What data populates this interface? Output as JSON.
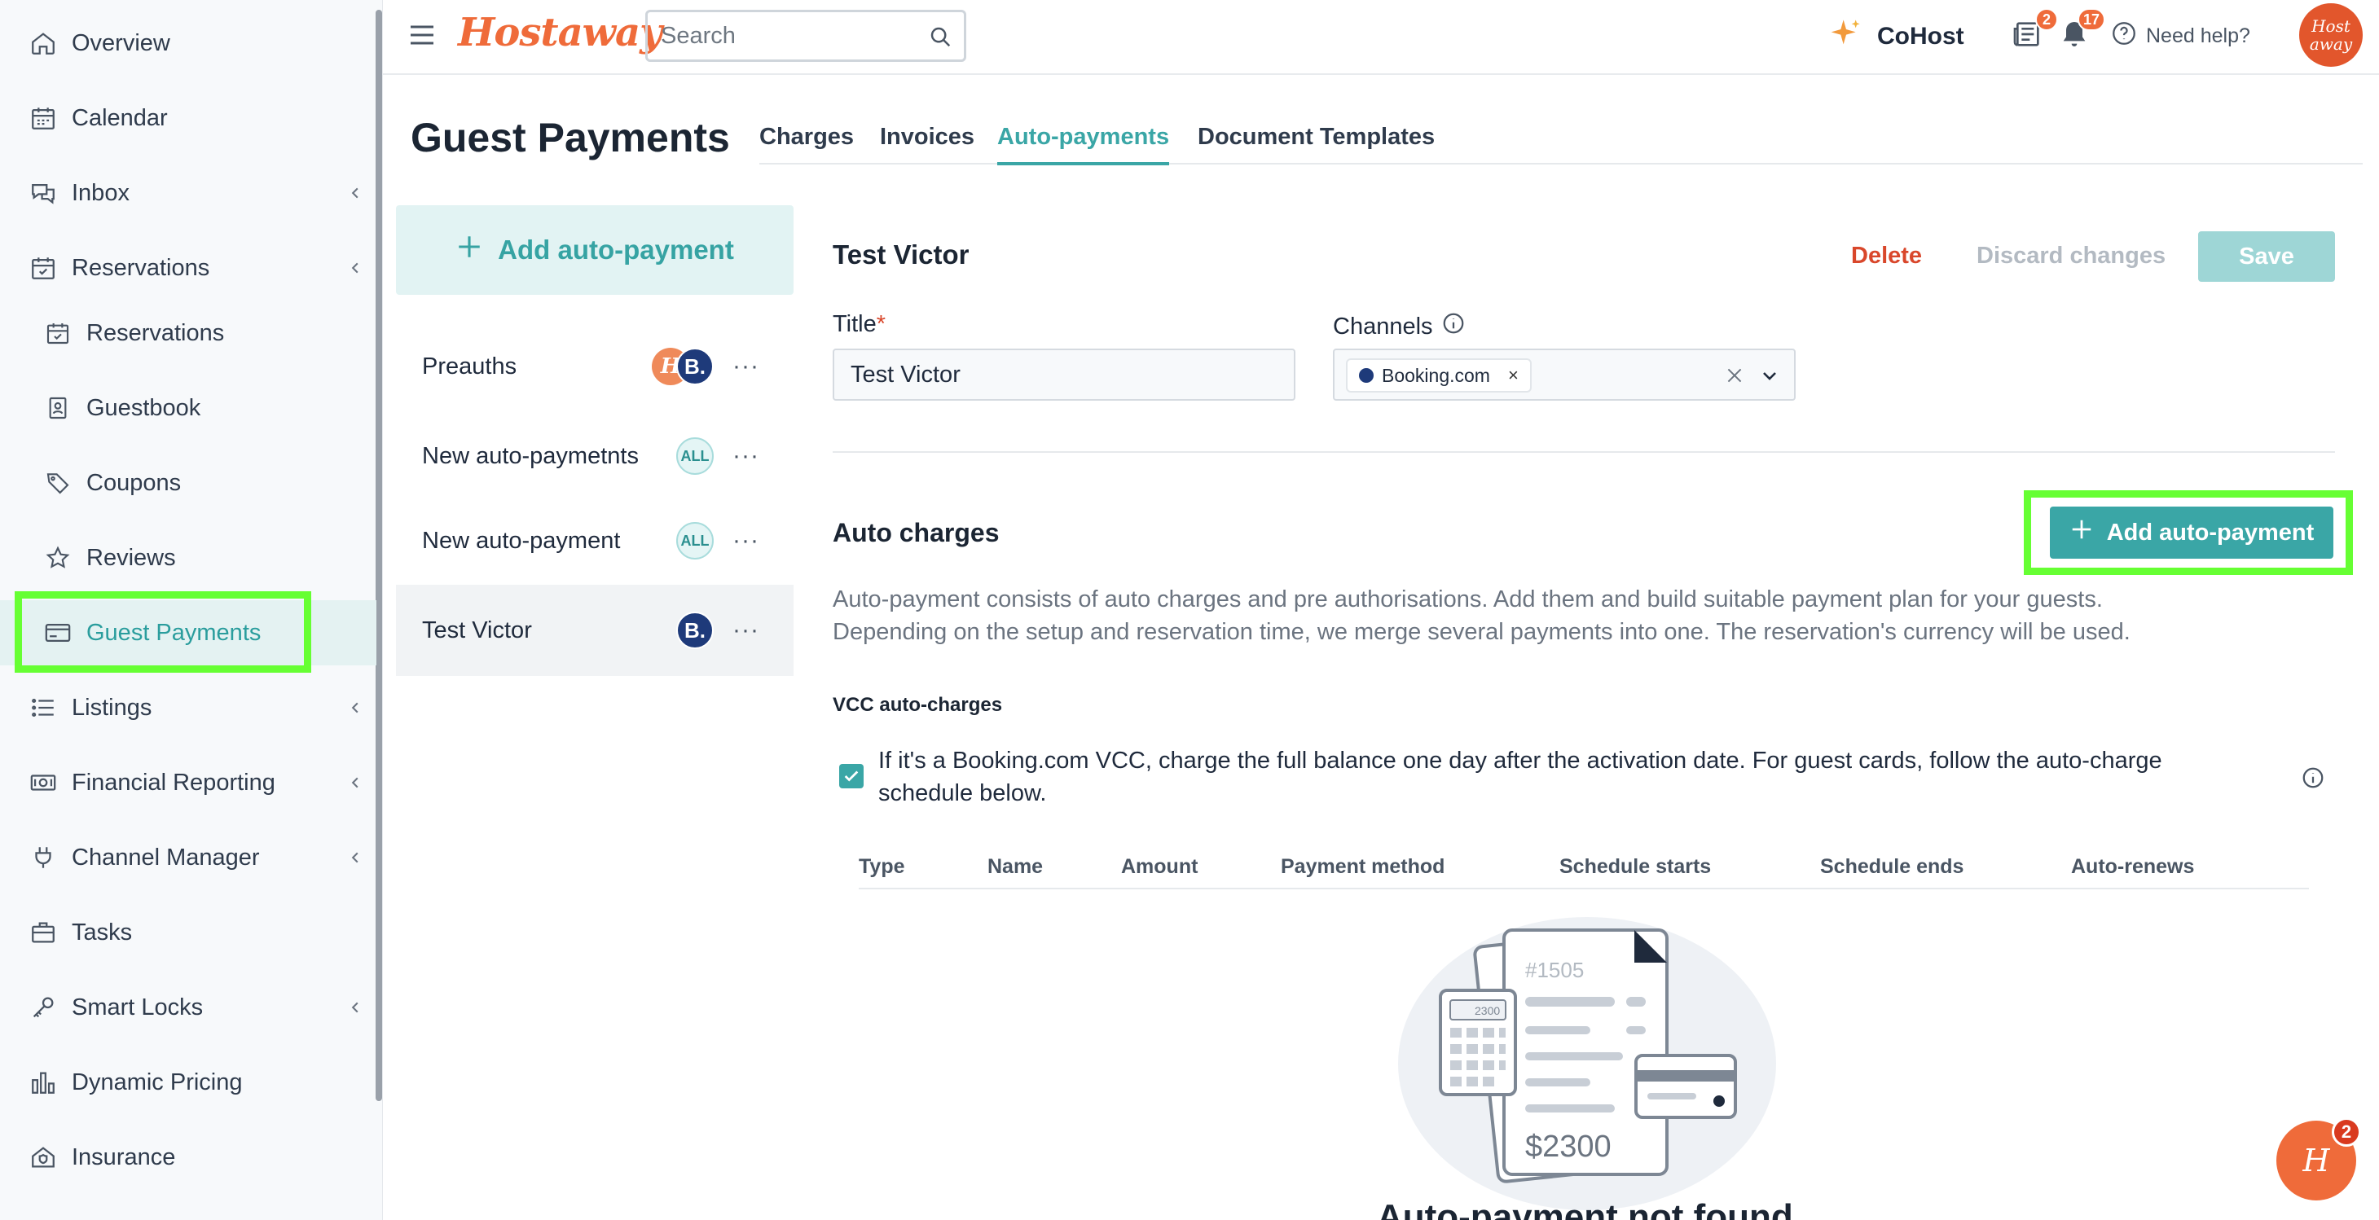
{
  "sidebar": {
    "items": [
      {
        "label": "Overview",
        "icon": "home-icon"
      },
      {
        "label": "Calendar",
        "icon": "calendar-icon"
      },
      {
        "label": "Inbox",
        "icon": "chat-bubbles-icon"
      },
      {
        "label": "Reservations",
        "icon": "calendar-check-icon"
      },
      {
        "label": "Reservations",
        "icon": "calendar-check-icon"
      },
      {
        "label": "Guestbook",
        "icon": "guestbook-icon"
      },
      {
        "label": "Coupons",
        "icon": "tag-icon"
      },
      {
        "label": "Reviews",
        "icon": "star-icon"
      },
      {
        "label": "Guest Payments",
        "icon": "credit-card-icon"
      },
      {
        "label": "Listings",
        "icon": "list-icon"
      },
      {
        "label": "Financial Reporting",
        "icon": "cash-icon"
      },
      {
        "label": "Channel Manager",
        "icon": "plug-icon"
      },
      {
        "label": "Tasks",
        "icon": "briefcase-icon"
      },
      {
        "label": "Smart Locks",
        "icon": "key-icon"
      },
      {
        "label": "Dynamic Pricing",
        "icon": "bar-chart-icon"
      },
      {
        "label": "Insurance",
        "icon": "home-shield-icon"
      }
    ],
    "active": "Guest Payments"
  },
  "topbar": {
    "logo": "Hostaway",
    "search_placeholder": "Search",
    "cohost_label": "CoHost",
    "news_badge": "2",
    "notifications_badge": "17",
    "help_label": "Need help?",
    "avatar_text": "Host away"
  },
  "page": {
    "title": "Guest Payments",
    "tabs": [
      {
        "label": "Charges",
        "active": false
      },
      {
        "label": "Invoices",
        "active": false
      },
      {
        "label": "Auto-payments",
        "active": true
      },
      {
        "label": "Document Templates",
        "active": false
      }
    ]
  },
  "list": {
    "add_label": "Add auto-payment",
    "rows": [
      {
        "name": "Preauths",
        "chips": [
          "H",
          "B."
        ]
      },
      {
        "name": "New auto-paymetnts",
        "chips": [
          "ALL"
        ]
      },
      {
        "name": "New auto-payment",
        "chips": [
          "ALL"
        ]
      },
      {
        "name": "Test Victor",
        "chips": [
          "B."
        ]
      }
    ],
    "more_label": "···"
  },
  "detail": {
    "title": "Test Victor",
    "delete_label": "Delete",
    "discard_label": "Discard changes",
    "save_label": "Save",
    "title_field_label": "Title",
    "required_mark": "*",
    "title_value": "Test Victor",
    "channels_label": "Channels",
    "channel_tag": "Booking.com",
    "tag_remove": "×",
    "auto_charges_title": "Auto charges",
    "add_auto_payment_label": "Add auto-payment",
    "description_line1": "Auto-payment consists of auto charges and pre authorisations. Add them and build suitable payment plan for your guests.",
    "description_line2": "Depending on the setup and reservation time, we merge several payments into one. The reservation's currency will be used.",
    "vcc_title": "VCC auto-charges",
    "vcc_checked": true,
    "vcc_text": "If it's a Booking.com VCC, charge the full balance one day after the activation date. For guest cards, follow the auto-charge schedule below.",
    "table_headers": [
      "Type",
      "Name",
      "Amount",
      "Payment method",
      "Schedule starts",
      "Schedule ends",
      "Auto-renews"
    ],
    "illustration": {
      "invoice_number": "#1505",
      "amount": "$2300",
      "calc_display": "2300"
    },
    "empty_title": "Auto-payment not found"
  },
  "chat": {
    "badge": "2",
    "glyph": "H"
  },
  "colors": {
    "accent": "#3aa6a6",
    "brand": "#ef6b3a",
    "danger": "#d9472b",
    "highlight": "#66ff33"
  }
}
